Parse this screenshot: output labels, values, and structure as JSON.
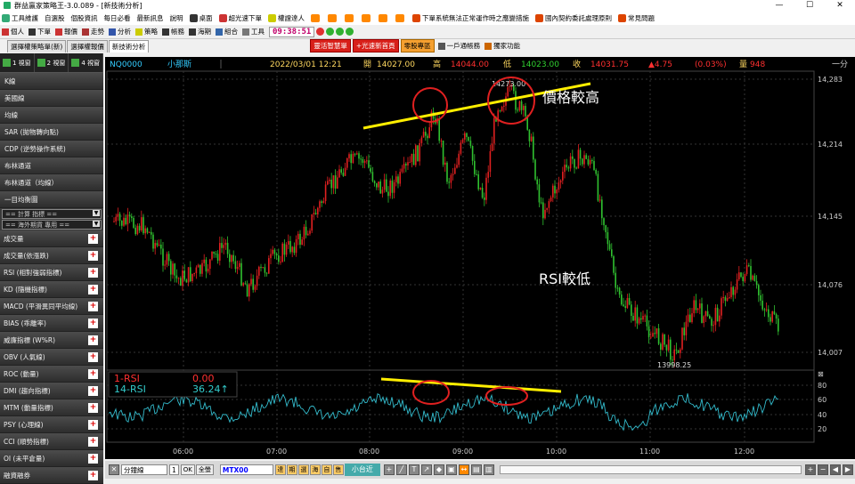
{
  "window": {
    "title": "群益贏家策略王-3.0.089 - [新技術分析]",
    "min": "—",
    "max": "☐",
    "close": "✕"
  },
  "menu": [
    {
      "label": "工具維護",
      "color": "#3a7"
    },
    {
      "label": "自選股",
      "color": ""
    },
    {
      "label": "個股資訊",
      "color": ""
    },
    {
      "label": "每日必看",
      "color": ""
    },
    {
      "label": "最新訊息",
      "color": ""
    },
    {
      "label": "說明",
      "color": ""
    },
    {
      "label": "桌面",
      "color": "#333"
    },
    {
      "label": "超光速下單",
      "color": "#c33"
    },
    {
      "label": "權證達人",
      "color": "#cc0"
    },
    {
      "label": "1",
      "color": "#f80"
    },
    {
      "label": "2",
      "color": "#f80"
    },
    {
      "label": "3",
      "color": "#f80"
    },
    {
      "label": "4",
      "color": "#f80"
    },
    {
      "label": "5",
      "color": "#f80"
    },
    {
      "label": "6",
      "color": "#f80"
    },
    {
      "label": "下單系統無法正常運作時之應變措施",
      "color": "#d40"
    },
    {
      "label": "國內契約委託處理原則",
      "color": "#d40"
    },
    {
      "label": "常見問題",
      "color": "#d40"
    }
  ],
  "toolbar": {
    "buttons": [
      {
        "label": "個人",
        "color": "#c33"
      },
      {
        "label": "下單",
        "color": "#333"
      },
      {
        "label": "報價",
        "color": "#c33"
      },
      {
        "label": "走勢",
        "color": "#a33"
      },
      {
        "label": "分析",
        "color": "#35a"
      },
      {
        "label": "策略",
        "color": "#cc0"
      },
      {
        "label": "帳務",
        "color": "#333"
      },
      {
        "label": "海期",
        "color": "#333"
      },
      {
        "label": "組合",
        "color": "#36a"
      },
      {
        "label": "工具",
        "color": "#777"
      }
    ],
    "clock": "09:38:51"
  },
  "tabs": [
    {
      "label": "選擇權策略單(新)",
      "active": false
    },
    {
      "label": "選擇權報價",
      "active": false
    },
    {
      "label": "新技術分析",
      "active": true
    }
  ],
  "quick_buttons": {
    "red1": "靈活智慧單",
    "red2": "+光速新首頁",
    "orange": "零股專區",
    "plain1": "一戶通帳務",
    "plain2": "獨家功能"
  },
  "sidebar": {
    "view_buttons": [
      "1 視窗",
      "2 視窗",
      "4 視窗"
    ],
    "items": [
      "K線",
      "美國線",
      "均線",
      "SAR (拋物轉向點)",
      "CDP (逆勢操作系統)",
      "布林通道",
      "布林通道（均線）",
      "一目均衡圖"
    ],
    "select1": "== 計算 指標 ==",
    "select2": "== 海外期貨 專用 ==",
    "indicators": [
      "成交量",
      "成交量(依漲跌)",
      "RSI (相對強弱指標)",
      "KD (隨機指標)",
      "MACD (平滑異同平均線)",
      "BIAS (乖離率)",
      "威廉指標 (W%R)",
      "OBV (人氣線)",
      "ROC (動量)",
      "DMI (趨向指標)",
      "MTM (動量指標)",
      "PSY (心理線)",
      "CCI (順勢指標)",
      "OI (未平倉量)",
      "融資融券"
    ]
  },
  "quote": {
    "symbol": "NQ0000",
    "name": "小那斯",
    "datetime": "2022/03/01 12:21",
    "open_label": "開",
    "open": "14027.00",
    "high_label": "高",
    "high": "14044.00",
    "low_label": "低",
    "low": "14023.00",
    "close_label": "收",
    "close": "14031.75",
    "change": "▲4.75",
    "pct": "(0.03%)",
    "vol_label": "量",
    "vol": "948",
    "period": "一分"
  },
  "chart_data": {
    "type": "candlestick",
    "price_axis_ticks": [
      "14,283",
      "14,214",
      "14,145",
      "14,076",
      "14,007"
    ],
    "rsi_axis_ticks": [
      "80",
      "60",
      "40",
      "20"
    ],
    "time_ticks": [
      "06:00",
      "07:00",
      "08:00",
      "09:00",
      "10:00",
      "11:00",
      "12:00"
    ],
    "high_label": "14273.00",
    "low_label": "13998.25",
    "annotations": {
      "price_high": "價格較高",
      "rsi_low": "RSI較低"
    },
    "rsi_legend": [
      {
        "name": "1-RSI",
        "value": "0.00",
        "color": "#ff3030"
      },
      {
        "name": "14-RSI",
        "value": "36.24↑",
        "color": "#33cccc"
      }
    ],
    "colors": {
      "up": "#e02020",
      "down": "#30c030",
      "rsi": "#33bbcc",
      "annotation": "#ffee00",
      "circle": "#e02020"
    }
  },
  "bottombar": {
    "period": "分鐘線",
    "qty": "1",
    "ok": "OK",
    "full": "全螢",
    "symbol": "MTX00",
    "chips": [
      "達",
      "期",
      "選",
      "海",
      "自",
      "售"
    ],
    "big_button": "小台近"
  }
}
